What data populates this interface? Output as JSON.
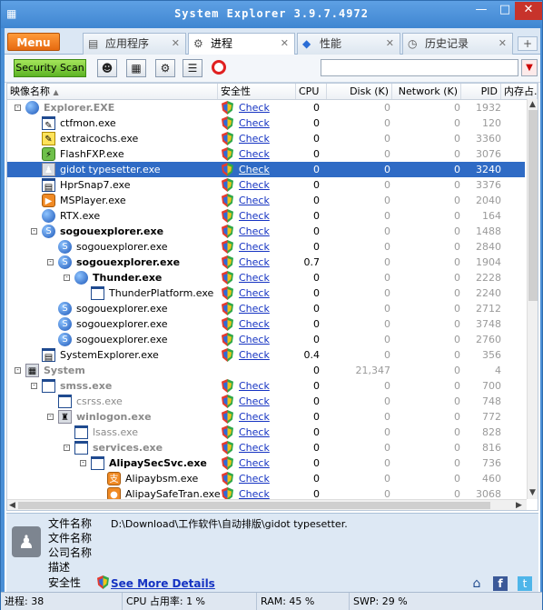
{
  "window": {
    "title": "System Explorer 3.9.7.4972"
  },
  "tabs": [
    {
      "label": "Menu"
    },
    {
      "label": "应用程序",
      "icon": "doc-icon"
    },
    {
      "label": "进程",
      "icon": "gear-icon"
    },
    {
      "label": "性能",
      "icon": "puzzle-icon"
    },
    {
      "label": "历史记录",
      "icon": "clock-icon"
    }
  ],
  "toolbar": {
    "security_scan": "Security Scan",
    "search_value": ""
  },
  "columns": {
    "name": "映像名称",
    "safety": "安全性",
    "cpu": "CPU",
    "disk": "Disk (K)",
    "network": "Network (K)",
    "pid": "PID",
    "mem": "内存占..."
  },
  "rows": [
    {
      "name": "Explorer.EXE",
      "cpu": "0",
      "disk": "0",
      "net": "0",
      "pid": "1932",
      "check": "Check"
    },
    {
      "name": "ctfmon.exe",
      "cpu": "0",
      "disk": "0",
      "net": "0",
      "pid": "120",
      "check": "Check"
    },
    {
      "name": "extraicochs.exe",
      "cpu": "0",
      "disk": "0",
      "net": "0",
      "pid": "3360",
      "check": "Check"
    },
    {
      "name": "FlashFXP.exe",
      "cpu": "0",
      "disk": "0",
      "net": "0",
      "pid": "3076",
      "check": "Check"
    },
    {
      "name": "gidot typesetter.exe",
      "cpu": "0",
      "disk": "0",
      "net": "0",
      "pid": "3240",
      "check": "Check"
    },
    {
      "name": "HprSnap7.exe",
      "cpu": "0",
      "disk": "0",
      "net": "0",
      "pid": "3376",
      "check": "Check"
    },
    {
      "name": "MSPlayer.exe",
      "cpu": "0",
      "disk": "0",
      "net": "0",
      "pid": "2040",
      "check": "Check"
    },
    {
      "name": "RTX.exe",
      "cpu": "0",
      "disk": "0",
      "net": "0",
      "pid": "164",
      "check": "Check"
    },
    {
      "name": "sogouexplorer.exe",
      "cpu": "0",
      "disk": "0",
      "net": "0",
      "pid": "1488",
      "check": "Check"
    },
    {
      "name": "sogouexplorer.exe",
      "cpu": "0",
      "disk": "0",
      "net": "0",
      "pid": "2840",
      "check": "Check"
    },
    {
      "name": "sogouexplorer.exe",
      "cpu": "0.7",
      "disk": "0",
      "net": "0",
      "pid": "1904",
      "check": "Check"
    },
    {
      "name": "Thunder.exe",
      "cpu": "0",
      "disk": "0",
      "net": "0",
      "pid": "2228",
      "check": "Check"
    },
    {
      "name": "ThunderPlatform.exe",
      "cpu": "0",
      "disk": "0",
      "net": "0",
      "pid": "2240",
      "check": "Check"
    },
    {
      "name": "sogouexplorer.exe",
      "cpu": "0",
      "disk": "0",
      "net": "0",
      "pid": "2712",
      "check": "Check"
    },
    {
      "name": "sogouexplorer.exe",
      "cpu": "0",
      "disk": "0",
      "net": "0",
      "pid": "3748",
      "check": "Check"
    },
    {
      "name": "sogouexplorer.exe",
      "cpu": "0",
      "disk": "0",
      "net": "0",
      "pid": "2760",
      "check": "Check"
    },
    {
      "name": "SystemExplorer.exe",
      "cpu": "0.4",
      "disk": "0",
      "net": "0",
      "pid": "356",
      "check": "Check"
    },
    {
      "name": "System",
      "cpu": "0",
      "disk": "21,347",
      "net": "0",
      "pid": "4",
      "check": ""
    },
    {
      "name": "smss.exe",
      "cpu": "0",
      "disk": "0",
      "net": "0",
      "pid": "700",
      "check": "Check"
    },
    {
      "name": "csrss.exe",
      "cpu": "0",
      "disk": "0",
      "net": "0",
      "pid": "748",
      "check": "Check"
    },
    {
      "name": "winlogon.exe",
      "cpu": "0",
      "disk": "0",
      "net": "0",
      "pid": "772",
      "check": "Check"
    },
    {
      "name": "lsass.exe",
      "cpu": "0",
      "disk": "0",
      "net": "0",
      "pid": "828",
      "check": "Check"
    },
    {
      "name": "services.exe",
      "cpu": "0",
      "disk": "0",
      "net": "0",
      "pid": "816",
      "check": "Check"
    },
    {
      "name": "AlipaySecSvc.exe",
      "cpu": "0",
      "disk": "0",
      "net": "0",
      "pid": "736",
      "check": "Check"
    },
    {
      "name": "Alipaybsm.exe",
      "cpu": "0",
      "disk": "0",
      "net": "0",
      "pid": "460",
      "check": "Check"
    },
    {
      "name": "AlipaySafeTran.exe",
      "cpu": "0",
      "disk": "0",
      "net": "0",
      "pid": "3068",
      "check": "Check"
    }
  ],
  "details": {
    "file_name_label": "文件名称",
    "file_name_value": "D:\\Download\\工作软件\\自动排版\\gidot typesetter.",
    "file_desc_label": "文件名称",
    "company_label": "公司名称",
    "description_label": "描述",
    "safety_label": "安全性",
    "see_more": "See More Details"
  },
  "status": {
    "processes": "进程: 38",
    "cpu": "CPU 占用率: 1 %",
    "ram": "RAM: 45 %",
    "swp": "SWP: 29 %"
  }
}
